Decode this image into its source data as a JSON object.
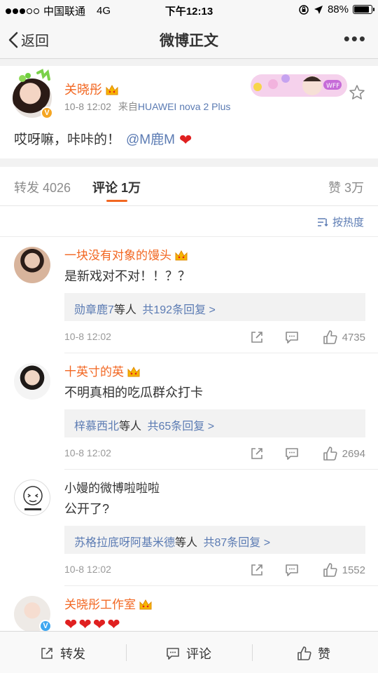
{
  "status_bar": {
    "carrier": "中国联通",
    "network": "4G",
    "time": "下午12:13",
    "battery": "88%",
    "battery_level": 0.88
  },
  "nav": {
    "back_label": "返回",
    "title": "微博正文"
  },
  "post": {
    "author": "关晓彤",
    "time": "10-8 12:02",
    "source_prefix": "来自",
    "source": "HUAWEI nova 2 Plus",
    "text": "哎呀嘛，咔咔的！",
    "mention": "@M鹿M"
  },
  "tabs": {
    "reposts_label": "转发",
    "reposts_count": "4026",
    "comments_label": "评论",
    "comments_count": "1万",
    "likes_label": "赞",
    "likes_count": "3万"
  },
  "sort": {
    "label": "按热度"
  },
  "comments": [
    {
      "author": "一块没有对象的馒头",
      "text": "是新戏对不对！！？？",
      "reply_users": "勋章鹿7",
      "reply_mid": "等人",
      "reply_count": "共192条回复 >",
      "time": "10-8 12:02",
      "likes": "4735"
    },
    {
      "author": "十英寸的英",
      "text": "不明真相的吃瓜群众打卡",
      "reply_users": "梓慕西北",
      "reply_mid": "等人",
      "reply_count": "共65条回复 >",
      "time": "10-8 12:02",
      "likes": "2694"
    },
    {
      "author": "小嫚的微博啦啦啦",
      "text": "公开了?",
      "reply_users": "苏格拉底呀阿基米德",
      "reply_mid": "等人",
      "reply_count": "共87条回复 >",
      "time": "10-8 12:02",
      "likes": "1552"
    },
    {
      "author": "关晓彤工作室",
      "text": ""
    }
  ],
  "bottom_bar": {
    "repost": "转发",
    "comment": "评论",
    "like": "赞"
  },
  "colors": {
    "accent_orange": "#f26722",
    "link_blue": "#5b7bb3",
    "heart_red": "#e02020",
    "verified_gold": "#f5a623"
  },
  "icons": [
    "back-chevron-icon",
    "more-icon",
    "star-icon",
    "sort-icon",
    "share-icon",
    "comment-icon",
    "like-icon",
    "heart-icon",
    "crown-badge-icon",
    "verified-badge-icon"
  ]
}
